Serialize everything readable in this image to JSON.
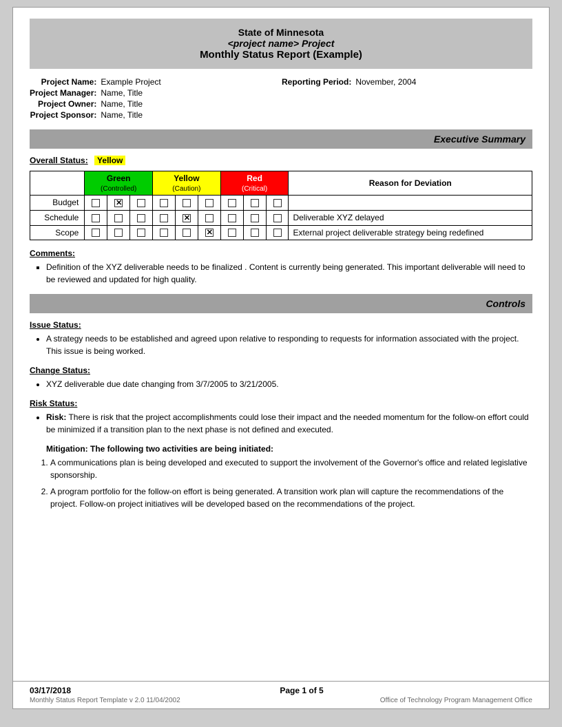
{
  "header": {
    "line1": "State of Minnesota",
    "line2": "<project name> Project",
    "line3": "Monthly Status Report (Example)"
  },
  "project_info": {
    "name_label": "Project Name:",
    "name_value": "Example Project",
    "reporting_label": "Reporting Period:",
    "reporting_value": "November, 2004",
    "manager_label": "Project Manager:",
    "manager_value": "Name, Title",
    "owner_label": "Project Owner:",
    "owner_value": "Name, Title",
    "sponsor_label": "Project Sponsor:",
    "sponsor_value": "Name, Title"
  },
  "executive_summary": {
    "section_title": "Executive Summary",
    "overall_status_label": "Overall Status:",
    "overall_status_value": "Yellow",
    "table": {
      "headers": {
        "empty": "",
        "green": "Green",
        "green_sub": "(Controlled)",
        "yellow": "Yellow",
        "yellow_sub": "(Caution)",
        "red": "Red",
        "red_sub": "(Critical)",
        "reason": "Reason for Deviation"
      },
      "rows": [
        {
          "label": "Budget",
          "green_checks": [
            false,
            true,
            false
          ],
          "yellow_checks": [
            false,
            false,
            false
          ],
          "red_checks": [
            false,
            false,
            false
          ],
          "reason": ""
        },
        {
          "label": "Schedule",
          "green_checks": [
            false,
            false,
            false
          ],
          "yellow_checks": [
            false,
            true,
            false
          ],
          "red_checks": [
            false,
            false,
            false
          ],
          "reason": "Deliverable XYZ delayed"
        },
        {
          "label": "Scope",
          "green_checks": [
            false,
            false,
            false
          ],
          "yellow_checks": [
            false,
            false,
            true
          ],
          "red_checks": [
            false,
            false,
            false
          ],
          "reason": "External project deliverable strategy being redefined"
        }
      ]
    },
    "comments_label": "Comments:",
    "comments": [
      "Definition of the XYZ deliverable  needs to be finalized .  Content is currently being generated.  This important deliverable will need to be reviewed and updated for high quality."
    ]
  },
  "controls": {
    "section_title": "Controls",
    "issue_status_label": "Issue Status:",
    "issue_bullets": [
      "A strategy needs to be established  and agreed upon relative to  responding to  requests for information associated with the project.  This issue is being worked."
    ],
    "change_status_label": "Change Status:",
    "change_bullets": [
      "XYZ deliverable due date changing from   3/7/2005 to 3/21/2005."
    ],
    "risk_status_label": "Risk Status:",
    "risk_bullets": [
      "Risk: There is risk that the project accomplishments could lose their impact and the needed momentum for the follow-on effort could be   minimized if a transition plan to the next phase is not defined and executed."
    ],
    "mitigation_label": "Mitigation:",
    "mitigation_intro": "The following two activities are being initiated:",
    "mitigation_items": [
      "A communications plan is being developed and executed to support the involvement of the Governor's office and related legislative sponsorship.",
      "A program portfolio for the follow-on effort is being generated.  A transition work plan will capture the recommendations of the project.  Follow-on project initiatives will be developed based on the recommendations of the project."
    ]
  },
  "footer": {
    "date": "03/17/2018",
    "page": "Page 1 of 5",
    "template_info": "Monthly Status Report Template  v 2.0  11/04/2002",
    "office": "Office of Technology Program Management Office"
  }
}
